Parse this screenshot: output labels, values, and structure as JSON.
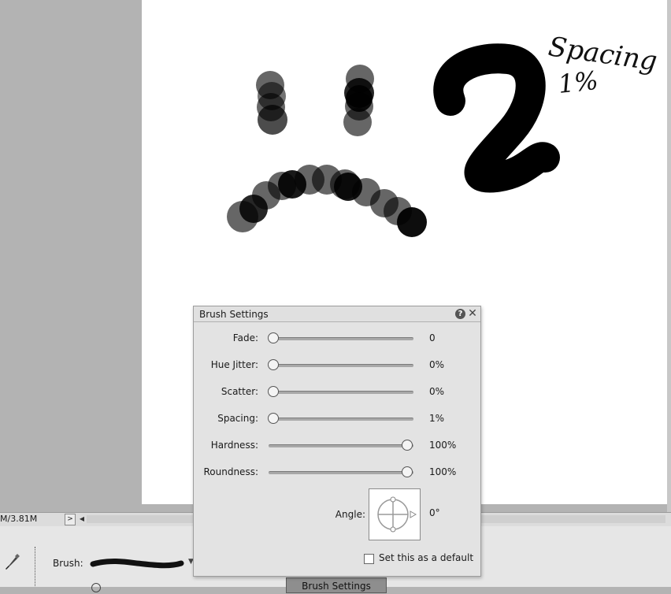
{
  "canvas": {
    "annotation_line1": "Spacing",
    "annotation_line2": "1%"
  },
  "status_bar": {
    "doc_size": "M/3.81M",
    "arrow": ">"
  },
  "options_bar": {
    "brush_label": "Brush:",
    "brush_settings_button": "Brush Settings"
  },
  "panel": {
    "title": "Brush Settings",
    "help": "?",
    "close": "✕",
    "sliders": [
      {
        "label": "Fade:",
        "value": "0",
        "level": 0
      },
      {
        "label": "Hue Jitter:",
        "value": "0%",
        "level": 0
      },
      {
        "label": "Scatter:",
        "value": "0%",
        "level": 0
      },
      {
        "label": "Spacing:",
        "value": "1%",
        "level": 0
      },
      {
        "label": "Hardness:",
        "value": "100%",
        "level": 1
      },
      {
        "label": "Roundness:",
        "value": "100%",
        "level": 1
      }
    ],
    "angle_label": "Angle:",
    "angle_value": "0°",
    "default_checkbox_label": "Set this as a default",
    "default_checked": false
  }
}
